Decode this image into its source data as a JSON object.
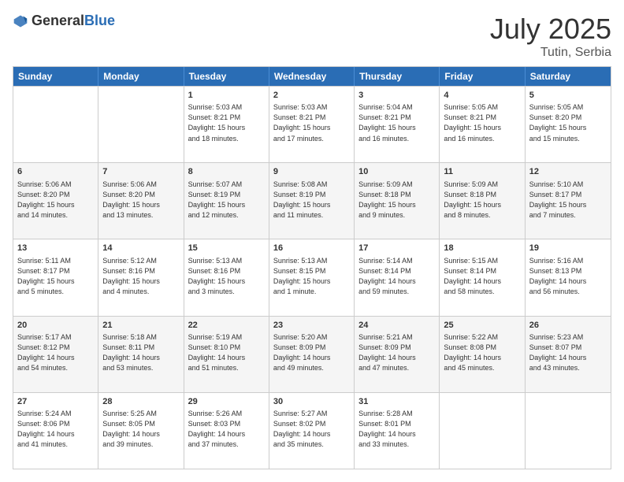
{
  "logo": {
    "general": "General",
    "blue": "Blue"
  },
  "title": "July 2025",
  "subtitle": "Tutin, Serbia",
  "header_days": [
    "Sunday",
    "Monday",
    "Tuesday",
    "Wednesday",
    "Thursday",
    "Friday",
    "Saturday"
  ],
  "rows": [
    [
      {
        "day": "",
        "lines": []
      },
      {
        "day": "",
        "lines": []
      },
      {
        "day": "1",
        "lines": [
          "Sunrise: 5:03 AM",
          "Sunset: 8:21 PM",
          "Daylight: 15 hours",
          "and 18 minutes."
        ]
      },
      {
        "day": "2",
        "lines": [
          "Sunrise: 5:03 AM",
          "Sunset: 8:21 PM",
          "Daylight: 15 hours",
          "and 17 minutes."
        ]
      },
      {
        "day": "3",
        "lines": [
          "Sunrise: 5:04 AM",
          "Sunset: 8:21 PM",
          "Daylight: 15 hours",
          "and 16 minutes."
        ]
      },
      {
        "day": "4",
        "lines": [
          "Sunrise: 5:05 AM",
          "Sunset: 8:21 PM",
          "Daylight: 15 hours",
          "and 16 minutes."
        ]
      },
      {
        "day": "5",
        "lines": [
          "Sunrise: 5:05 AM",
          "Sunset: 8:20 PM",
          "Daylight: 15 hours",
          "and 15 minutes."
        ]
      }
    ],
    [
      {
        "day": "6",
        "lines": [
          "Sunrise: 5:06 AM",
          "Sunset: 8:20 PM",
          "Daylight: 15 hours",
          "and 14 minutes."
        ]
      },
      {
        "day": "7",
        "lines": [
          "Sunrise: 5:06 AM",
          "Sunset: 8:20 PM",
          "Daylight: 15 hours",
          "and 13 minutes."
        ]
      },
      {
        "day": "8",
        "lines": [
          "Sunrise: 5:07 AM",
          "Sunset: 8:19 PM",
          "Daylight: 15 hours",
          "and 12 minutes."
        ]
      },
      {
        "day": "9",
        "lines": [
          "Sunrise: 5:08 AM",
          "Sunset: 8:19 PM",
          "Daylight: 15 hours",
          "and 11 minutes."
        ]
      },
      {
        "day": "10",
        "lines": [
          "Sunrise: 5:09 AM",
          "Sunset: 8:18 PM",
          "Daylight: 15 hours",
          "and 9 minutes."
        ]
      },
      {
        "day": "11",
        "lines": [
          "Sunrise: 5:09 AM",
          "Sunset: 8:18 PM",
          "Daylight: 15 hours",
          "and 8 minutes."
        ]
      },
      {
        "day": "12",
        "lines": [
          "Sunrise: 5:10 AM",
          "Sunset: 8:17 PM",
          "Daylight: 15 hours",
          "and 7 minutes."
        ]
      }
    ],
    [
      {
        "day": "13",
        "lines": [
          "Sunrise: 5:11 AM",
          "Sunset: 8:17 PM",
          "Daylight: 15 hours",
          "and 5 minutes."
        ]
      },
      {
        "day": "14",
        "lines": [
          "Sunrise: 5:12 AM",
          "Sunset: 8:16 PM",
          "Daylight: 15 hours",
          "and 4 minutes."
        ]
      },
      {
        "day": "15",
        "lines": [
          "Sunrise: 5:13 AM",
          "Sunset: 8:16 PM",
          "Daylight: 15 hours",
          "and 3 minutes."
        ]
      },
      {
        "day": "16",
        "lines": [
          "Sunrise: 5:13 AM",
          "Sunset: 8:15 PM",
          "Daylight: 15 hours",
          "and 1 minute."
        ]
      },
      {
        "day": "17",
        "lines": [
          "Sunrise: 5:14 AM",
          "Sunset: 8:14 PM",
          "Daylight: 14 hours",
          "and 59 minutes."
        ]
      },
      {
        "day": "18",
        "lines": [
          "Sunrise: 5:15 AM",
          "Sunset: 8:14 PM",
          "Daylight: 14 hours",
          "and 58 minutes."
        ]
      },
      {
        "day": "19",
        "lines": [
          "Sunrise: 5:16 AM",
          "Sunset: 8:13 PM",
          "Daylight: 14 hours",
          "and 56 minutes."
        ]
      }
    ],
    [
      {
        "day": "20",
        "lines": [
          "Sunrise: 5:17 AM",
          "Sunset: 8:12 PM",
          "Daylight: 14 hours",
          "and 54 minutes."
        ]
      },
      {
        "day": "21",
        "lines": [
          "Sunrise: 5:18 AM",
          "Sunset: 8:11 PM",
          "Daylight: 14 hours",
          "and 53 minutes."
        ]
      },
      {
        "day": "22",
        "lines": [
          "Sunrise: 5:19 AM",
          "Sunset: 8:10 PM",
          "Daylight: 14 hours",
          "and 51 minutes."
        ]
      },
      {
        "day": "23",
        "lines": [
          "Sunrise: 5:20 AM",
          "Sunset: 8:09 PM",
          "Daylight: 14 hours",
          "and 49 minutes."
        ]
      },
      {
        "day": "24",
        "lines": [
          "Sunrise: 5:21 AM",
          "Sunset: 8:09 PM",
          "Daylight: 14 hours",
          "and 47 minutes."
        ]
      },
      {
        "day": "25",
        "lines": [
          "Sunrise: 5:22 AM",
          "Sunset: 8:08 PM",
          "Daylight: 14 hours",
          "and 45 minutes."
        ]
      },
      {
        "day": "26",
        "lines": [
          "Sunrise: 5:23 AM",
          "Sunset: 8:07 PM",
          "Daylight: 14 hours",
          "and 43 minutes."
        ]
      }
    ],
    [
      {
        "day": "27",
        "lines": [
          "Sunrise: 5:24 AM",
          "Sunset: 8:06 PM",
          "Daylight: 14 hours",
          "and 41 minutes."
        ]
      },
      {
        "day": "28",
        "lines": [
          "Sunrise: 5:25 AM",
          "Sunset: 8:05 PM",
          "Daylight: 14 hours",
          "and 39 minutes."
        ]
      },
      {
        "day": "29",
        "lines": [
          "Sunrise: 5:26 AM",
          "Sunset: 8:03 PM",
          "Daylight: 14 hours",
          "and 37 minutes."
        ]
      },
      {
        "day": "30",
        "lines": [
          "Sunrise: 5:27 AM",
          "Sunset: 8:02 PM",
          "Daylight: 14 hours",
          "and 35 minutes."
        ]
      },
      {
        "day": "31",
        "lines": [
          "Sunrise: 5:28 AM",
          "Sunset: 8:01 PM",
          "Daylight: 14 hours",
          "and 33 minutes."
        ]
      },
      {
        "day": "",
        "lines": []
      },
      {
        "day": "",
        "lines": []
      }
    ]
  ]
}
